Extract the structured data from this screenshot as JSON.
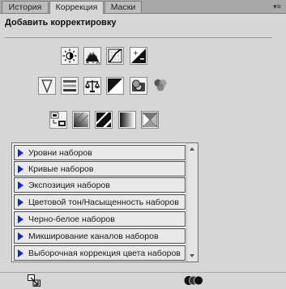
{
  "tabs": [
    {
      "label": "История"
    },
    {
      "label": "Коррекция"
    },
    {
      "label": "Маски"
    }
  ],
  "panel": {
    "title": "Добавить корректировку"
  },
  "icon_rows": [
    [
      "brightness-contrast-icon",
      "levels-icon",
      "curves-icon",
      "exposure-icon"
    ],
    [
      "vibrance-icon",
      "hue-saturation-icon",
      "color-balance-icon",
      "black-white-icon",
      "photo-filter-icon",
      "channel-mixer-icon"
    ],
    [
      "invert-icon",
      "posterize-icon",
      "threshold-icon",
      "gradient-map-icon",
      "selective-color-icon"
    ]
  ],
  "presets": {
    "items": [
      {
        "label": "Уровни наборов"
      },
      {
        "label": "Кривые наборов"
      },
      {
        "label": "Экспозиция наборов"
      },
      {
        "label": "Цветовой тон/Насыщенность наборов"
      },
      {
        "label": "Черно-белое наборов"
      },
      {
        "label": "Микширование каналов наборов"
      },
      {
        "label": "Выборочная коррекция цвета наборов"
      }
    ]
  },
  "footer": {
    "icons": [
      "auto-select-mask-icon",
      "clip-layers-icon"
    ]
  },
  "colors": {
    "panel_bg": "#d6d6d6",
    "tabbar_bg": "#a9a9a9",
    "triangle": "#1b2c9c"
  }
}
